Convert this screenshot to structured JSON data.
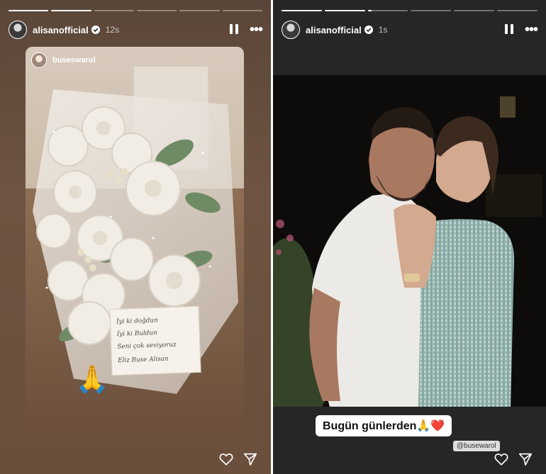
{
  "left_story": {
    "username": "alisanofficial",
    "time": "12s",
    "progress": [
      1,
      1,
      0,
      0,
      0,
      0
    ],
    "shared_post": {
      "username": "buseswarol",
      "note_lines": [
        "İyi ki doğdun",
        "İyi ki Buldun",
        "Seni çok seviyoruz",
        "Eliz Buse Alisan"
      ],
      "emoji": "🙏"
    }
  },
  "right_story": {
    "username": "alisanofficial",
    "time": "1s",
    "progress": [
      1,
      1,
      0.1,
      0,
      0,
      0
    ],
    "caption": "Bugün günlerden🙏❤️",
    "mention": "@busewarol"
  },
  "icons": [
    "pause-icon",
    "more-icon",
    "verified-icon",
    "heart-icon",
    "send-icon"
  ]
}
